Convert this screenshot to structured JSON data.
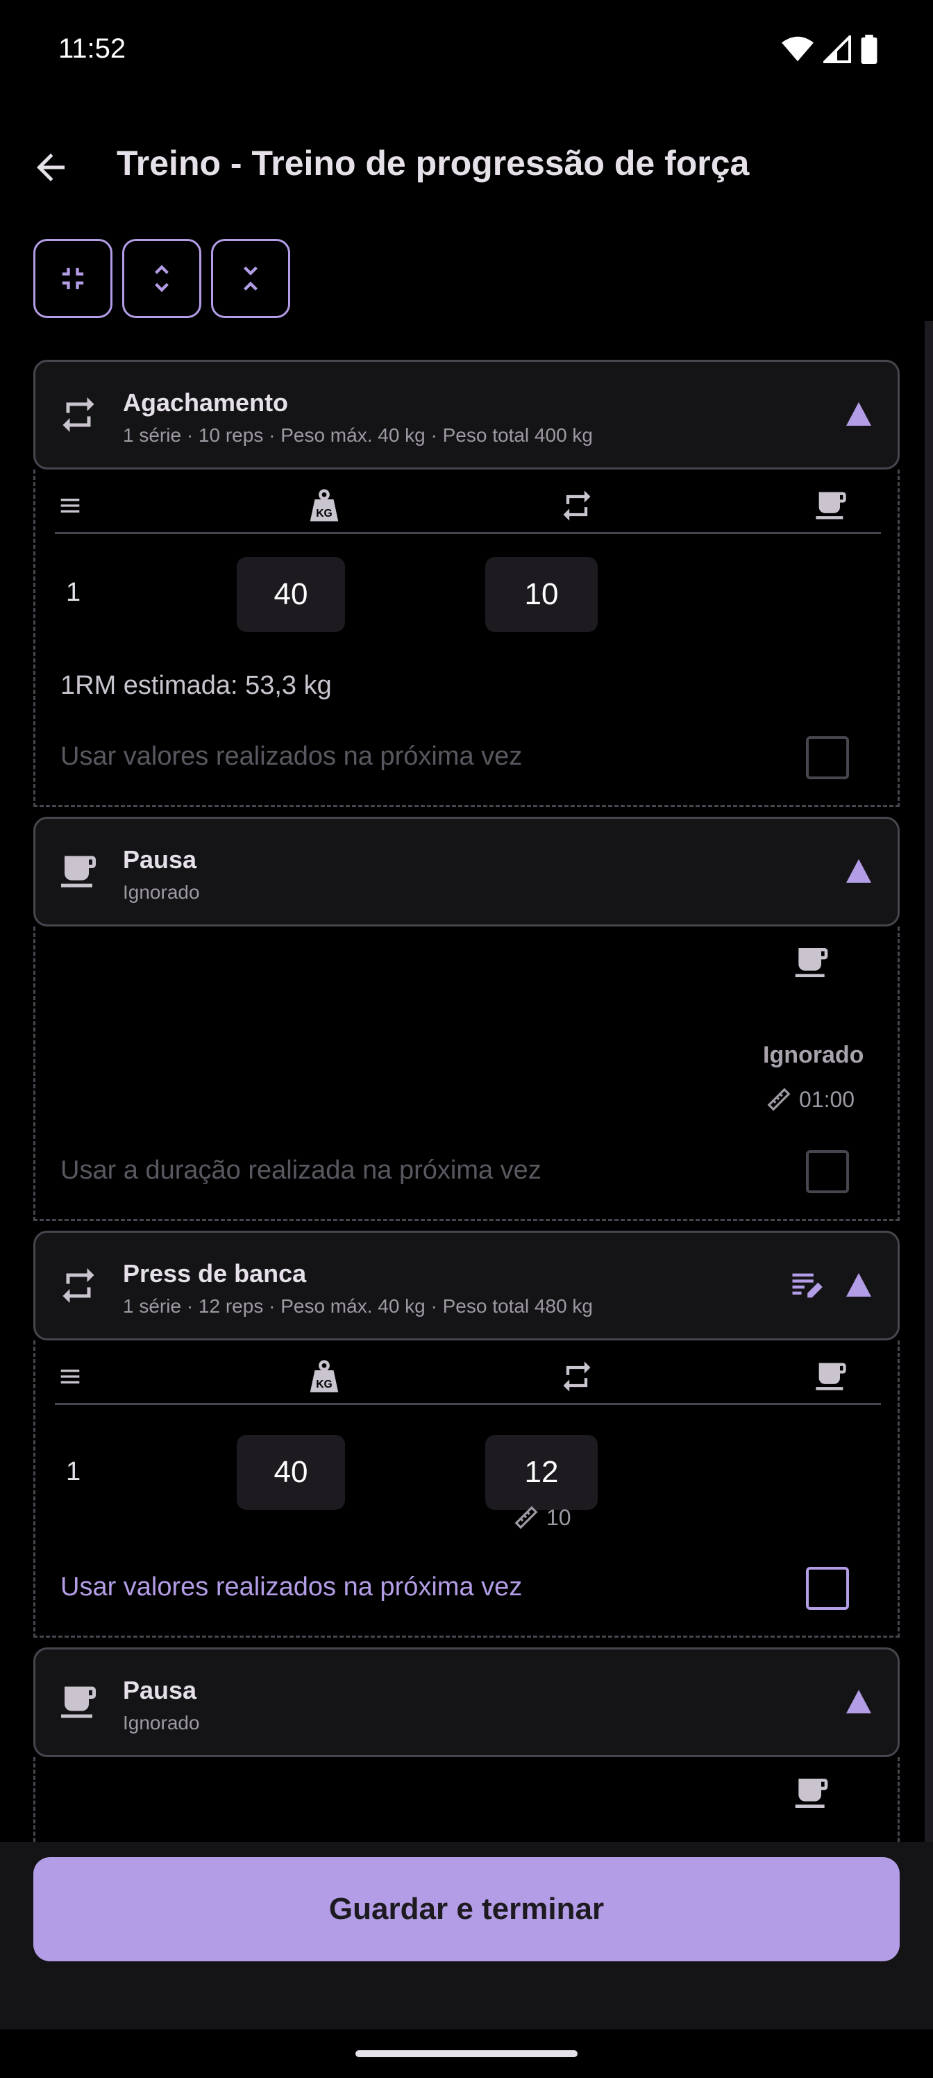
{
  "status_bar": {
    "time": "11:52"
  },
  "header": {
    "title": "Treino - Treino de progressão de força"
  },
  "toolbar": {
    "icons": [
      "collapse-all-icon",
      "expand-icon",
      "collapse-icon"
    ]
  },
  "exercises": [
    {
      "type": "exercise",
      "title": "Agachamento",
      "subtitle": "1 série · 10 reps · Peso máx. 40 kg · Peso total 400 kg",
      "rows": [
        {
          "num": "1",
          "weight": "40",
          "reps": "10"
        }
      ],
      "estimated_1rm": "1RM estimada: 53,3 kg",
      "option_label": "Usar valores realizados na próxima vez",
      "option_checked": false
    },
    {
      "type": "rest",
      "title": "Pausa",
      "subtitle": "Ignorado",
      "status": "Ignorado",
      "duration": "01:00",
      "option_label": "Usar a duração realizada na próxima vez",
      "option_checked": false
    },
    {
      "type": "exercise",
      "title": "Press de banca",
      "subtitle": "1 série · 12 reps · Peso máx. 40 kg · Peso total 480 kg",
      "rows": [
        {
          "num": "1",
          "weight": "40",
          "reps": "12",
          "previous_reps": "10"
        }
      ],
      "option_label": "Usar valores realizados na próxima vez",
      "option_checked": false
    },
    {
      "type": "rest",
      "title": "Pausa",
      "subtitle": "Ignorado"
    }
  ],
  "footer": {
    "save_label": "Guardar e terminar"
  },
  "colors": {
    "accent": "#b39de6",
    "surface": "#141316",
    "outline": "#49454f",
    "background": "#000000"
  }
}
